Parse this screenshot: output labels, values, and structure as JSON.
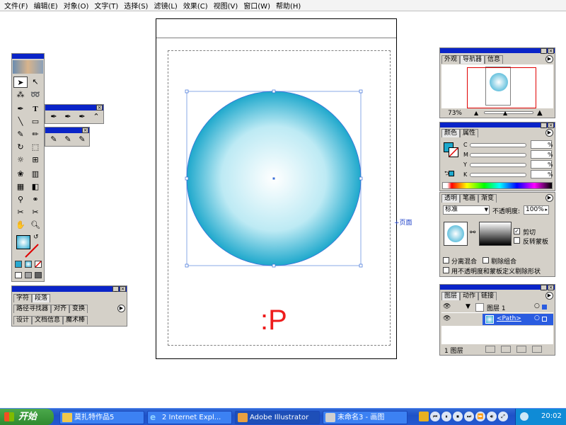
{
  "menu": [
    "文件(F)",
    "编辑(E)",
    "对象(O)",
    "文字(T)",
    "选择(S)",
    "滤镜(L)",
    "效果(C)",
    "视图(V)",
    "窗口(W)",
    "帮助(H)"
  ],
  "canvas": {
    "overlay_text": ":P",
    "overlay_color": "#ee1c1c",
    "page_label": "页面",
    "circle_gradient_inner": "#ffffff",
    "circle_gradient_outer": "#2ab0d0"
  },
  "navigator": {
    "tabs": [
      "外观",
      "导航器",
      "信息"
    ],
    "zoom": "73%"
  },
  "color_panel": {
    "tabs": [
      "颜色",
      "属性"
    ],
    "channels": [
      "C",
      "M",
      "Y",
      "K"
    ],
    "unit": "%"
  },
  "transparency": {
    "tabs": [
      "透明",
      "笔画",
      "渐变"
    ],
    "mode": "标准",
    "opacity_label": "不透明度:",
    "opacity_value": "100",
    "opacity_unit": "%",
    "clip_label": "剪切",
    "invert_label": "反转蒙板",
    "isolate_label": "分离混合",
    "knockout_label": "剔除组合",
    "shape_label": "用不透明度和蒙板定义剔除形状"
  },
  "layers": {
    "tabs": [
      "图层",
      "动作",
      "链接"
    ],
    "layer_name": "图层 1",
    "path_name": "<Path>",
    "footer": "1 图层"
  },
  "bottom_panel": {
    "row1_tabs": [
      "字符",
      "段落"
    ],
    "row2_tabs": [
      "路径寻找器",
      "对齐",
      "变换"
    ],
    "row3_tabs": [
      "设计",
      "文档信息",
      "魔术棒"
    ]
  },
  "taskbar": {
    "start": "开始",
    "tasks": [
      "莫扎特作品5",
      "2 Internet Expl...",
      "Adobe Illustrator",
      "未命名3 - 画图"
    ],
    "clock": "20:02"
  },
  "colors": {
    "titlebar": "#0a24c8",
    "taskbar": "#245edb",
    "start": "#3c9a3c"
  }
}
